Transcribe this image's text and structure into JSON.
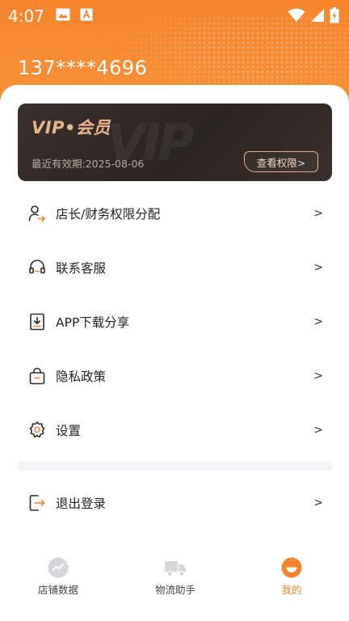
{
  "status_bar": {
    "time": "4:07"
  },
  "header": {
    "phone": "137****4696",
    "accent_color": "#f5842c"
  },
  "vip_card": {
    "title": "VIP•会员",
    "watermark": "VIP",
    "expiry_label": "最近有效期:",
    "expiry_date": "2025-08-06",
    "button_label": "查看权限>"
  },
  "menu": {
    "items": [
      {
        "label": "店长/财务权限分配",
        "icon": "user-transfer-icon",
        "chevron": ">"
      },
      {
        "label": "联系客服",
        "icon": "headset-icon",
        "chevron": ">"
      },
      {
        "label": "APP下载分享",
        "icon": "download-share-icon",
        "chevron": ">"
      },
      {
        "label": "隐私政策",
        "icon": "privacy-bag-icon",
        "chevron": ">"
      },
      {
        "label": "设置",
        "icon": "gear-icon",
        "chevron": ">"
      }
    ],
    "logout": {
      "label": "退出登录",
      "icon": "logout-icon",
      "chevron": ">"
    }
  },
  "bottom_nav": {
    "items": [
      {
        "label": "店铺数据",
        "icon": "store-data-icon",
        "active": false
      },
      {
        "label": "物流助手",
        "icon": "truck-icon",
        "active": false
      },
      {
        "label": "我的",
        "icon": "profile-icon",
        "active": true
      }
    ]
  }
}
